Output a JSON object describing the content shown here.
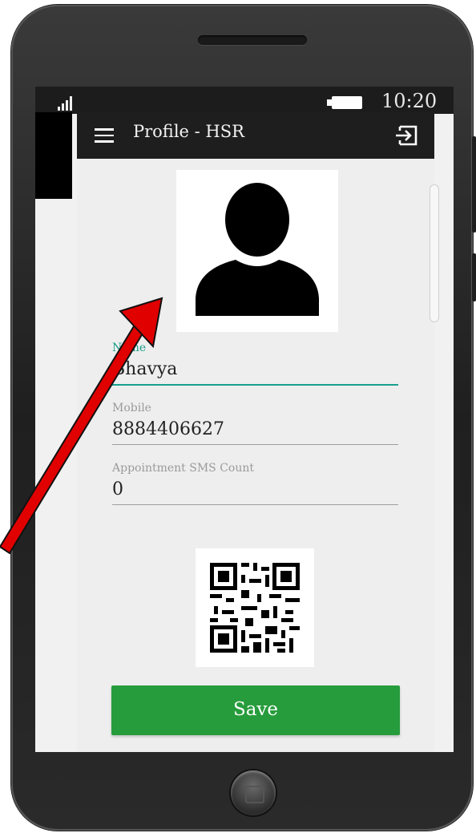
{
  "status_bar": {
    "time": "10:20"
  },
  "app_bar": {
    "title": "Profile - HSR"
  },
  "form": {
    "name_label": "Name",
    "name_value": "Bhavya",
    "mobile_label": "Mobile",
    "mobile_value": "8884406627",
    "sms_label": "Appointment SMS Count",
    "sms_value": "0"
  },
  "save_button": {
    "label": "Save"
  },
  "icons": {
    "menu": "hamburger-menu-icon",
    "logout": "logout-icon",
    "avatar": "user-silhouette-icon",
    "qr": "qr-code"
  },
  "colors": {
    "accent": "#1a9e8c",
    "save": "#279c3c",
    "app_bar": "#1e1e1e",
    "annotation_arrow": "#e00000"
  }
}
